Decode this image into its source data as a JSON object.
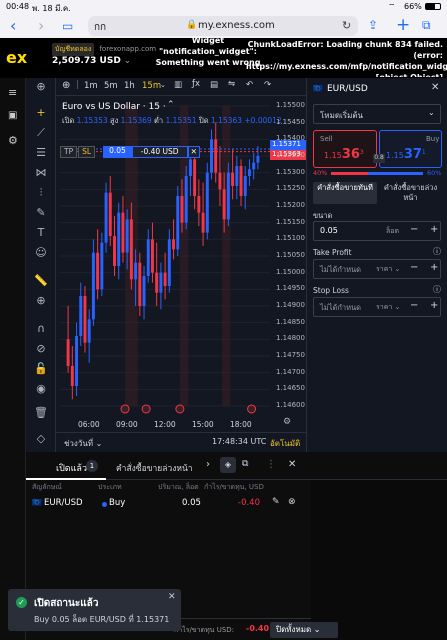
{
  "status_bar": {
    "time": "00:48",
    "date": "พ. 18 มี.ค.",
    "battery": "66%"
  },
  "browser": {
    "tab_label": "กก",
    "url": "my.exness.com"
  },
  "header": {
    "logo": "ex",
    "account_type": "บัญชีทดลอง",
    "account_name": "forexonapp.com",
    "balance": "2,509.73 USD",
    "widget_error": "Widget \"notification_widget\": Something went wrong",
    "chunk_error": "ChunkLoadError: Loading chunk 834 failed. (error: https://my.exness.com/mfp/notification_widget) [object Object]"
  },
  "chart_toolbar": {
    "timeframes": [
      "1m",
      "5m",
      "1h",
      "15m"
    ],
    "active_timeframe": "15m"
  },
  "chart": {
    "symbol_title": "Euro vs US Dollar · 15 ·",
    "ohlc_open_label": "เปิด",
    "ohlc_open": "1.15353",
    "ohlc_high_label": "สูง",
    "ohlc_high": "1.15369",
    "ohlc_low_label": "ต่ำ",
    "ohlc_low": "1.15351",
    "ohlc_close_label": "ปิด",
    "ohlc_close": "1.15363",
    "ohlc_change": "+0.00012",
    "position_tp": "TP",
    "position_sl": "SL",
    "position_volume": "0.05",
    "position_pnl": "-0.40 USD",
    "ask_tag": "1.15371",
    "bid_tag": "1.15363",
    "range_label": "ช่วงวันที่",
    "clock": "17:48:34 UTC",
    "auto_label": "อัตโนมัติ"
  },
  "chart_data": {
    "type": "candlestick",
    "y_ticks": [
      "1.15500",
      "1.15450",
      "1.15400",
      "1.15350",
      "1.15300",
      "1.15250",
      "1.15200",
      "1.15150",
      "1.15100",
      "1.15050",
      "1.15000",
      "1.14950",
      "1.14900",
      "1.14850",
      "1.14800",
      "1.14750",
      "1.14700",
      "1.14650",
      "1.14600"
    ],
    "x_ticks": [
      "06:00",
      "09:00",
      "12:00",
      "15:00",
      "18:00"
    ],
    "ylim": [
      1.146,
      1.155
    ],
    "candles": [
      [
        1.148,
        1.149,
        1.147,
        1.1472
      ],
      [
        1.1472,
        1.1478,
        1.1462,
        1.1466
      ],
      [
        1.1466,
        1.1485,
        1.1463,
        1.1481
      ],
      [
        1.1481,
        1.1497,
        1.1478,
        1.1493
      ],
      [
        1.1493,
        1.1496,
        1.1476,
        1.1479
      ],
      [
        1.1479,
        1.1489,
        1.1473,
        1.1486
      ],
      [
        1.1486,
        1.151,
        1.1484,
        1.1506
      ],
      [
        1.1506,
        1.1513,
        1.1492,
        1.1495
      ],
      [
        1.1495,
        1.1512,
        1.1493,
        1.1509
      ],
      [
        1.1509,
        1.1527,
        1.1506,
        1.1524
      ],
      [
        1.1524,
        1.1529,
        1.1508,
        1.1511
      ],
      [
        1.1511,
        1.1517,
        1.1499,
        1.1502
      ],
      [
        1.1502,
        1.1521,
        1.1498,
        1.1518
      ],
      [
        1.1518,
        1.1523,
        1.1503,
        1.1506
      ],
      [
        1.1506,
        1.1519,
        1.1501,
        1.1516
      ],
      [
        1.1516,
        1.1521,
        1.1495,
        1.1498
      ],
      [
        1.1498,
        1.1507,
        1.149,
        1.1503
      ],
      [
        1.1503,
        1.1506,
        1.1487,
        1.149
      ],
      [
        1.149,
        1.1502,
        1.1486,
        1.1499
      ],
      [
        1.1499,
        1.1513,
        1.1497,
        1.151
      ],
      [
        1.151,
        1.1515,
        1.1497,
        1.15
      ],
      [
        1.15,
        1.1509,
        1.149,
        1.1494
      ],
      [
        1.1494,
        1.1503,
        1.1489,
        1.15
      ],
      [
        1.15,
        1.1506,
        1.1492,
        1.1496
      ],
      [
        1.1496,
        1.1513,
        1.1494,
        1.151
      ],
      [
        1.151,
        1.1516,
        1.1504,
        1.1507
      ],
      [
        1.1507,
        1.1526,
        1.1505,
        1.1523
      ],
      [
        1.1523,
        1.1528,
        1.1512,
        1.1515
      ],
      [
        1.1515,
        1.1532,
        1.1513,
        1.1529
      ],
      [
        1.1529,
        1.1538,
        1.1523,
        1.1534
      ],
      [
        1.1534,
        1.1537,
        1.1519,
        1.1523
      ],
      [
        1.1523,
        1.1528,
        1.1514,
        1.1518
      ],
      [
        1.1518,
        1.1527,
        1.1508,
        1.1512
      ],
      [
        1.1512,
        1.1533,
        1.151,
        1.153
      ],
      [
        1.153,
        1.1543,
        1.1528,
        1.154
      ],
      [
        1.154,
        1.1545,
        1.1527,
        1.153
      ],
      [
        1.153,
        1.1538,
        1.152,
        1.1525
      ],
      [
        1.1525,
        1.153,
        1.1512,
        1.1516
      ],
      [
        1.1516,
        1.1533,
        1.1514,
        1.153
      ],
      [
        1.153,
        1.1537,
        1.1522,
        1.1526
      ],
      [
        1.1526,
        1.1535,
        1.1522,
        1.1532
      ],
      [
        1.1532,
        1.1534,
        1.152,
        1.1523
      ],
      [
        1.1523,
        1.1532,
        1.1519,
        1.1529
      ],
      [
        1.1529,
        1.1534,
        1.1526,
        1.1531
      ],
      [
        1.1531,
        1.1536,
        1.1528,
        1.1533
      ],
      [
        1.1533,
        1.1538,
        1.1531,
        1.1535
      ]
    ]
  },
  "order_panel": {
    "symbol": "EUR/USD",
    "mode": "โหมดเริ่มต้น",
    "sell_label": "Sell",
    "sell_price_prefix": "1.15",
    "sell_price_big": "36",
    "sell_price_sup": "3",
    "buy_label": "Buy",
    "buy_price_prefix": "1.15",
    "buy_price_big": "37",
    "buy_price_sup": "1",
    "spread": "0.8",
    "sell_pct": "40%",
    "buy_pct": "60%",
    "sell_ratio": 0.4,
    "tab_market": "คำสั่งซื้อขายทันที",
    "tab_pending": "คำสั่งซื้อขายล่วงหน้า",
    "volume_label": "ขนาด",
    "volume_value": "0.05",
    "volume_unit": "ล็อต",
    "tp_label": "Take Profit",
    "tp_value": "ไม่ได้กำหนด",
    "tp_unit": "ราคา",
    "sl_label": "Stop Loss",
    "sl_value": "ไม่ได้กำหนด",
    "sl_unit": "ราคา"
  },
  "positions": {
    "tab_open": "เปิดแล้ว",
    "open_count": "1",
    "tab_pending": "คำสั่งซื้อขายล่วงหน้า",
    "col_symbol": "สัญลักษณ์",
    "col_type": "ประเภท",
    "col_volume": "ปริมาณ, ล็อต",
    "col_pnl": "กำไร/ขาดทุน, USD",
    "rows": [
      {
        "symbol": "EUR/USD",
        "type": "Buy",
        "volume": "0.05",
        "pnl": "-0.40"
      }
    ],
    "total_label": "กำไร/ขาดทุน USD:",
    "total_value": "-0.40",
    "close_all": "ปิดทั้งหมด"
  },
  "toast": {
    "title": "เปิดสถานะแล้ว",
    "message": "Buy 0.05 ล็อต EUR/USD ที่ 1.15371"
  }
}
